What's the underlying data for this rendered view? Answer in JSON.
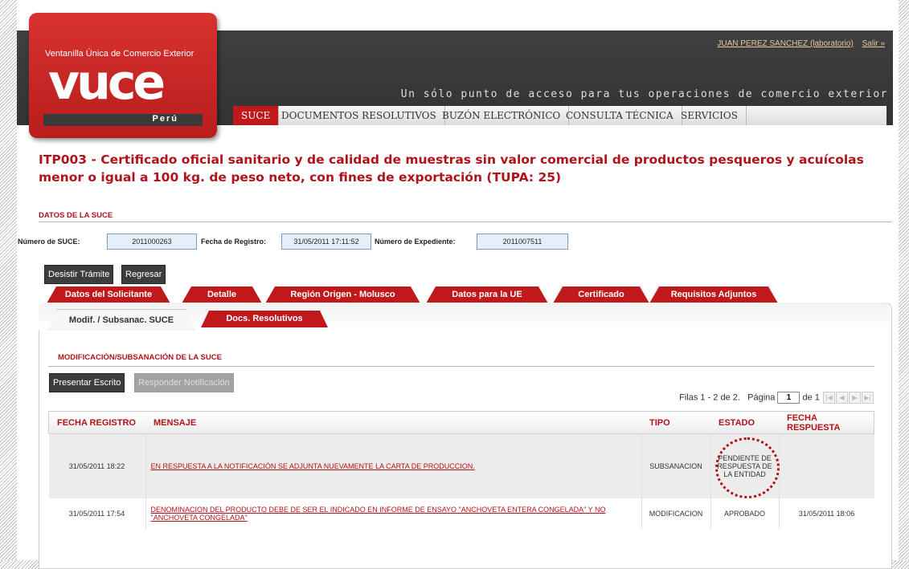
{
  "brand": {
    "subtitle": "Ventanilla Única de Comercio Exterior",
    "logo_text": "vuce",
    "country": "Perú"
  },
  "user": {
    "name": "JUAN PEREZ SANCHEZ (laboratorio)",
    "logout": "Salir »"
  },
  "slogan": "Un sólo punto de acceso para tus operaciones de comercio exterior",
  "nav": [
    "SUCE",
    "DOCUMENTOS RESOLUTIVOS",
    "BUZÓN ELECTRÓNICO",
    "CONSULTA TÉCNICA",
    "SERVICIOS"
  ],
  "title": "ITP003 - Certificado oficial sanitario y de calidad de muestras sin valor comercial de productos pesqueros y acuícolas menor o igual a 100 kg. de peso neto, con fines de exportación (TUPA: 25)",
  "suce": {
    "section": "DATOS DE LA SUCE",
    "num_label": "Número de SUCE:",
    "num_value": "2011000263",
    "fecha_label": "Fecha de Registro:",
    "fecha_value": "31/05/2011 17:11:52",
    "exp_label": "Número de Expediente:",
    "exp_value": "2011007511"
  },
  "actions": {
    "desistir": "Desistir Trámite",
    "regresar": "Regresar"
  },
  "tabs": [
    "Datos del Solicitante",
    "Detalle",
    "Región Origen - Molusco",
    "Datos para la UE",
    "Certificado",
    "Requisitos Adjuntos"
  ],
  "subtabs": [
    "Modif. / Subsanac. SUCE",
    "Docs. Resolutivos"
  ],
  "mod": {
    "section": "MODIFICACIÓN/SUBSANACIÓN DE LA SUCE",
    "presentar": "Presentar Escrito",
    "responder": "Responder Notificación"
  },
  "pager": {
    "filas": "Filas 1 - 2 de 2.",
    "pagina": "Página",
    "page": "1",
    "de": "de 1"
  },
  "table": {
    "headers": [
      "FECHA REGISTRO",
      "MENSAJE",
      "TIPO",
      "ESTADO",
      "FECHA RESPUESTA"
    ],
    "rows": [
      {
        "fecha": "31/05/2011 18:22",
        "mensaje": "EN RESPUESTA A LA NOTIFICACIÓN SE ADJUNTA NUEVAMENTE LA CARTA DE PRODUCCION.",
        "tipo": "SUBSANACION",
        "estado": "PENDIENTE DE RESPUESTA DE LA ENTIDAD",
        "respuesta": ""
      },
      {
        "fecha": "31/05/2011 17:54",
        "mensaje": "DENOMINACION DEL PRODUCTO DEBE DE SER EL INDICADO EN INFORME DE ENSAYO \"ANCHOVETA ENTERA CONGELADA\" Y NO \"ANCHOVETA CONGELADA\"",
        "tipo": "MODIFICACION",
        "estado": "APROBADO",
        "respuesta": "31/05/2011 18:06"
      }
    ]
  },
  "colors": {
    "brand_red": "#c0191c",
    "header_dark": "#3a3a3a",
    "title_red": "#b0131a"
  }
}
